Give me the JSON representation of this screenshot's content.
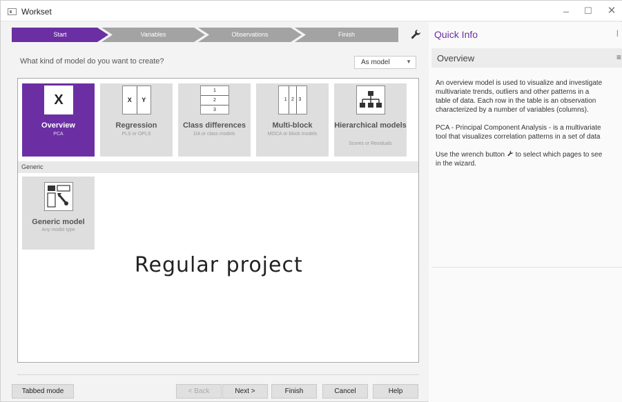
{
  "window": {
    "title": "Workset"
  },
  "wizard": {
    "steps": [
      "Start",
      "Variables",
      "Observations",
      "Finish"
    ],
    "question": "What kind of model do you want to create?",
    "mode_select": "As model",
    "model_types": [
      {
        "name": "Overview",
        "sub": "PCA",
        "icon": "X",
        "selected": true
      },
      {
        "name": "Regression",
        "sub": "PLS or OPLS",
        "icon_left": "X",
        "icon_right": "Y"
      },
      {
        "name": "Class differences",
        "sub": "DA or class models",
        "icon_cells": [
          "1",
          "2",
          "3"
        ]
      },
      {
        "name": "Multi-block",
        "sub": "MOCA or block models",
        "icon_cells": [
          "1",
          "2",
          "3"
        ]
      },
      {
        "name": "Hierarchical models",
        "sub": "Scores or Residuals"
      }
    ],
    "generic_group_label": "Generic",
    "generic_model": {
      "name": "Generic model",
      "sub": "Any model type"
    },
    "overlay_text": "Regular project",
    "buttons": {
      "tabbed_mode": "Tabbed mode",
      "back": "< Back",
      "next": "Next >",
      "finish": "Finish",
      "cancel": "Cancel",
      "help": "Help"
    }
  },
  "quick_info": {
    "title": "Quick Info",
    "card_title": "Overview",
    "para1_lines": [
      "An overview model is used to visualize and investigate",
      "multivariate trends, outliers and other patterns in a",
      "table of data. Each row in the table is an observation",
      "characterized by a number of variables (columns)."
    ],
    "para2_lines": [
      "PCA - Principal Component Analysis - is a multivariate",
      "tool that visualizes correlation patterns in a set of data"
    ],
    "para3_before": "Use the wrench button",
    "para3_after": "to select which pages to see",
    "para3_line2": "in the wizard."
  },
  "colors": {
    "accent": "#6b2fa3",
    "step_inactive": "#a3a3a3",
    "tile_bg": "#dedede"
  },
  "icons": [
    "app-icon",
    "wrench-icon",
    "chevron-down-icon",
    "hamburger-icon",
    "wrench-icon-inline"
  ]
}
